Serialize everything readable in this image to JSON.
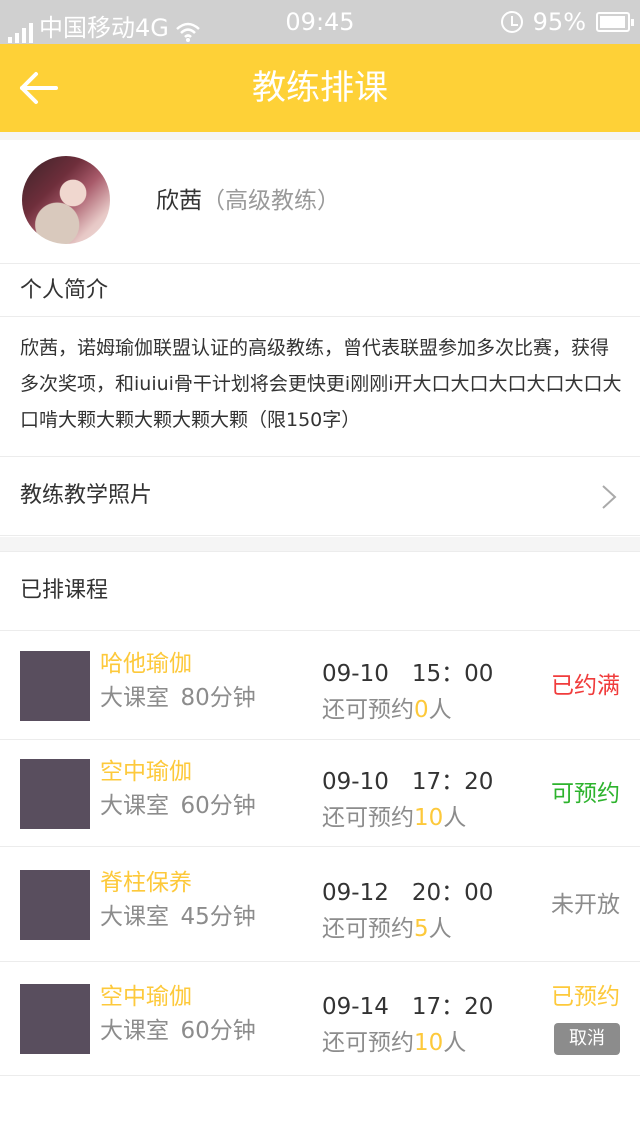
{
  "status_bar": {
    "carrier": "中国移动4G",
    "time": "09:45",
    "battery_percent": "95%",
    "battery_level": 0.95,
    "icons": [
      "signal-icon",
      "wifi-icon",
      "alarm-icon",
      "battery-icon"
    ]
  },
  "header": {
    "title": "教练排课",
    "back_icon": "back-arrow-icon"
  },
  "profile": {
    "name": "欣茜",
    "level": "（高级教练）"
  },
  "intro": {
    "title": "个人简介",
    "text": "欣茜，诺姆瑜伽联盟认证的高级教练，曾代表联盟参加多次比赛，获得多次奖项，和iuiui骨干计划将会更快更i刚刚i开大口大口大口大口大口大口啃大颗大颗大颗大颗大颗（限150字）"
  },
  "photos": {
    "label": "教练教学照片"
  },
  "schedule": {
    "title": "已排课程",
    "remain_prefix": "还可预约",
    "remain_suffix": "人",
    "courses": [
      {
        "name": "哈他瑜伽",
        "room": "大课室",
        "duration": "80分钟",
        "date": "09-10",
        "time": "15：00",
        "remain": "0",
        "status": "已约满",
        "status_color": "#f03c3c",
        "cancel": ""
      },
      {
        "name": "空中瑜伽",
        "room": "大课室",
        "duration": "60分钟",
        "date": "09-10",
        "time": "17：20",
        "remain": "10",
        "status": "可预约",
        "status_color": "#2db32d",
        "cancel": ""
      },
      {
        "name": "脊柱保养",
        "room": "大课室",
        "duration": "45分钟",
        "date": "09-12",
        "time": "20：00",
        "remain": "5",
        "status": "未开放",
        "status_color": "#8c8c8c",
        "cancel": ""
      },
      {
        "name": "空中瑜伽",
        "room": "大课室",
        "duration": "60分钟",
        "date": "09-14",
        "time": "17：20",
        "remain": "10",
        "status": "已预约",
        "status_color": "#fdc93b",
        "cancel": "取消"
      }
    ]
  },
  "colors": {
    "accent": "#fed137",
    "course_name": "#fdc93b",
    "thumb": "#594e5e"
  }
}
